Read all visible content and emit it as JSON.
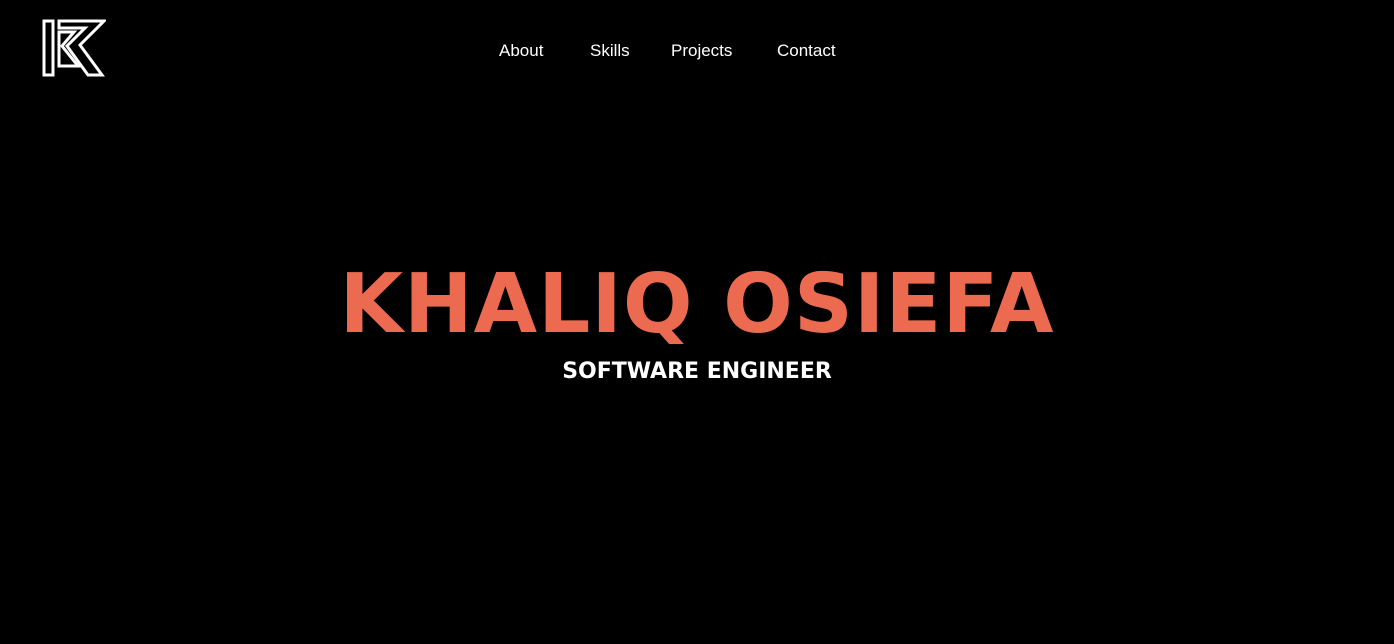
{
  "header": {
    "logo_icon": "k-monogram-logo-icon",
    "logo_color": "#ffffff"
  },
  "nav": {
    "items": [
      {
        "label": "About"
      },
      {
        "label": "Skills"
      },
      {
        "label": "Projects"
      },
      {
        "label": "Contact"
      }
    ]
  },
  "hero": {
    "name": "KHALIQ OSIEFA",
    "title": "SOFTWARE ENGINEER"
  },
  "colors": {
    "background": "#000000",
    "accent": "#ec6a50",
    "text": "#ffffff"
  }
}
